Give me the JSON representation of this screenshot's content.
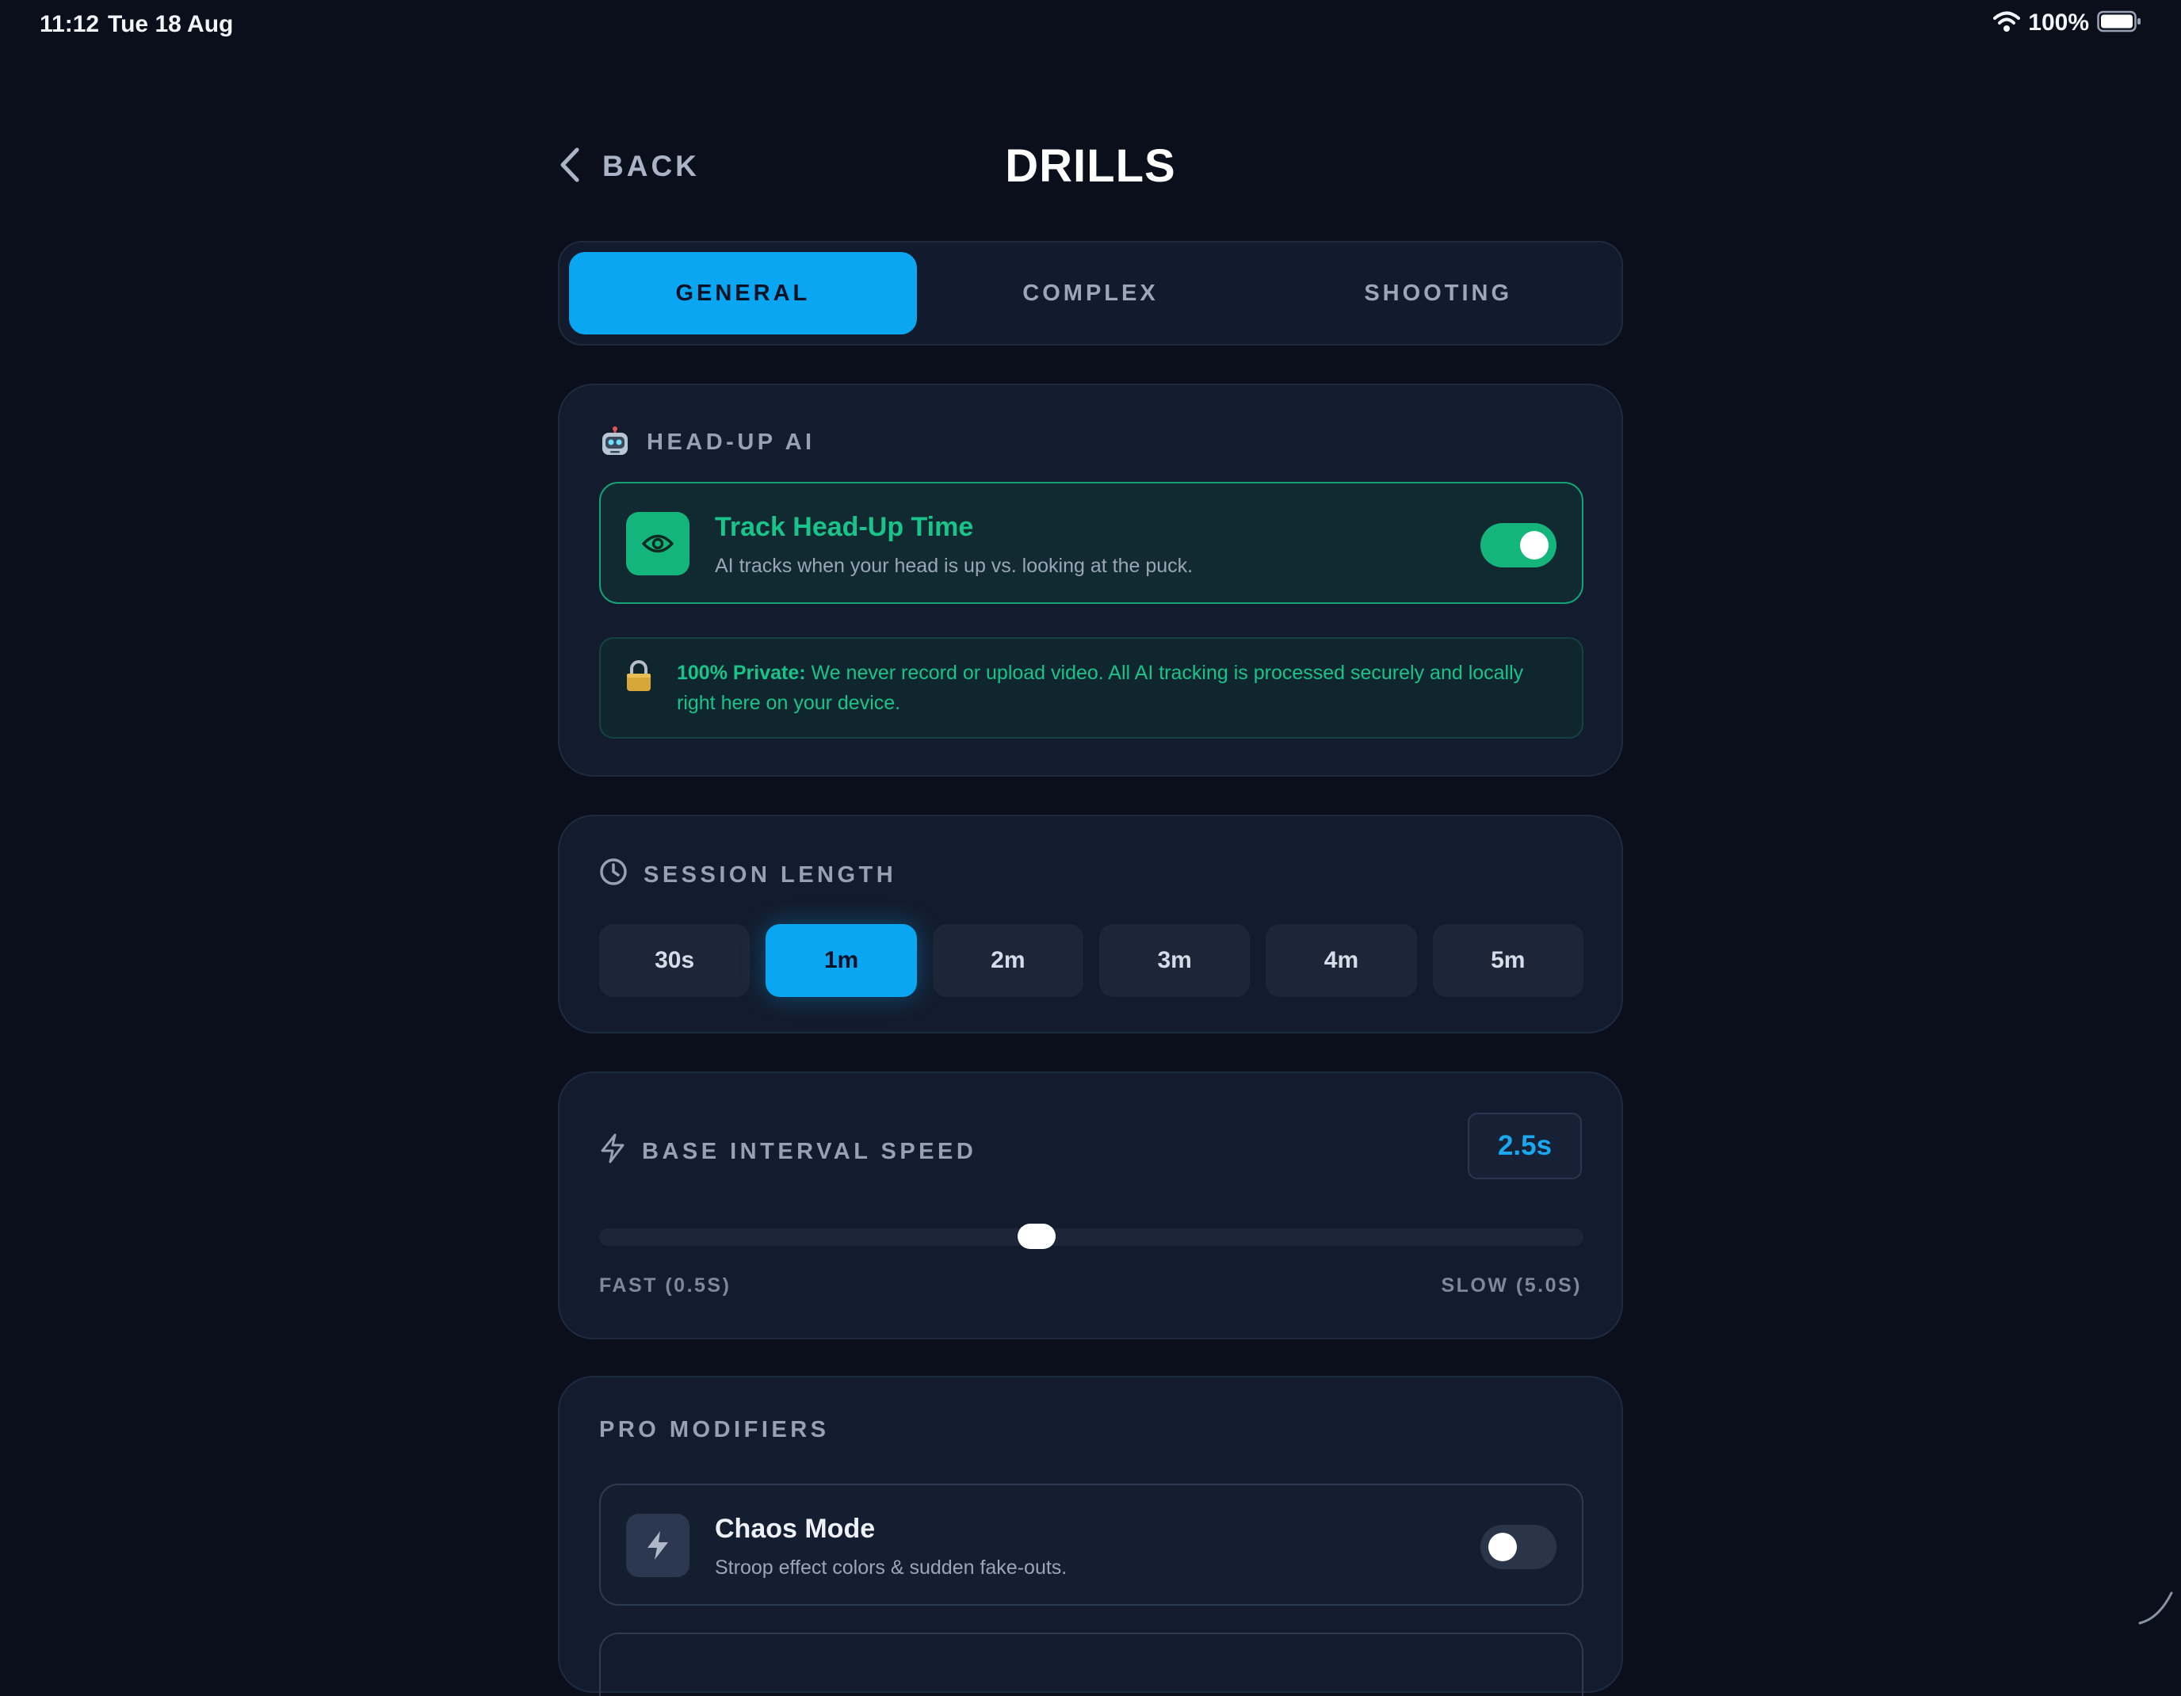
{
  "status": {
    "time": "11:12",
    "date": "Tue 18 Aug",
    "battery_text": "100%"
  },
  "header": {
    "back_label": "BACK",
    "title": "DRILLS"
  },
  "tabs": [
    {
      "label": "GENERAL",
      "active": true
    },
    {
      "label": "COMPLEX",
      "active": false
    },
    {
      "label": "SHOOTING",
      "active": false
    }
  ],
  "head_up_ai": {
    "section_title": "HEAD-UP AI",
    "track": {
      "title": "Track Head-Up Time",
      "subtitle": "AI tracks when your head is up vs. looking at the puck.",
      "enabled": true
    },
    "privacy": {
      "bold": "100% Private:",
      "text": " We never record or upload video. All AI tracking is processed securely and locally right here on your device."
    }
  },
  "session_length": {
    "section_title": "SESSION LENGTH",
    "options": [
      "30s",
      "1m",
      "2m",
      "3m",
      "4m",
      "5m"
    ],
    "selected": "1m"
  },
  "base_interval": {
    "section_title": "BASE INTERVAL SPEED",
    "value_display": "2.5s",
    "value": 2.5,
    "min": 0.5,
    "max": 5.0,
    "min_label": "FAST (0.5S)",
    "max_label": "SLOW (5.0S)"
  },
  "pro_modifiers": {
    "section_title": "PRO MODIFIERS",
    "chaos": {
      "title": "Chaos Mode",
      "subtitle": "Stroop effect colors & sudden fake-outs.",
      "enabled": false
    }
  },
  "colors": {
    "accent_blue": "#0aa6f2",
    "accent_green": "#14b57c",
    "background": "#0a0f1b",
    "card": "#131c2e"
  }
}
